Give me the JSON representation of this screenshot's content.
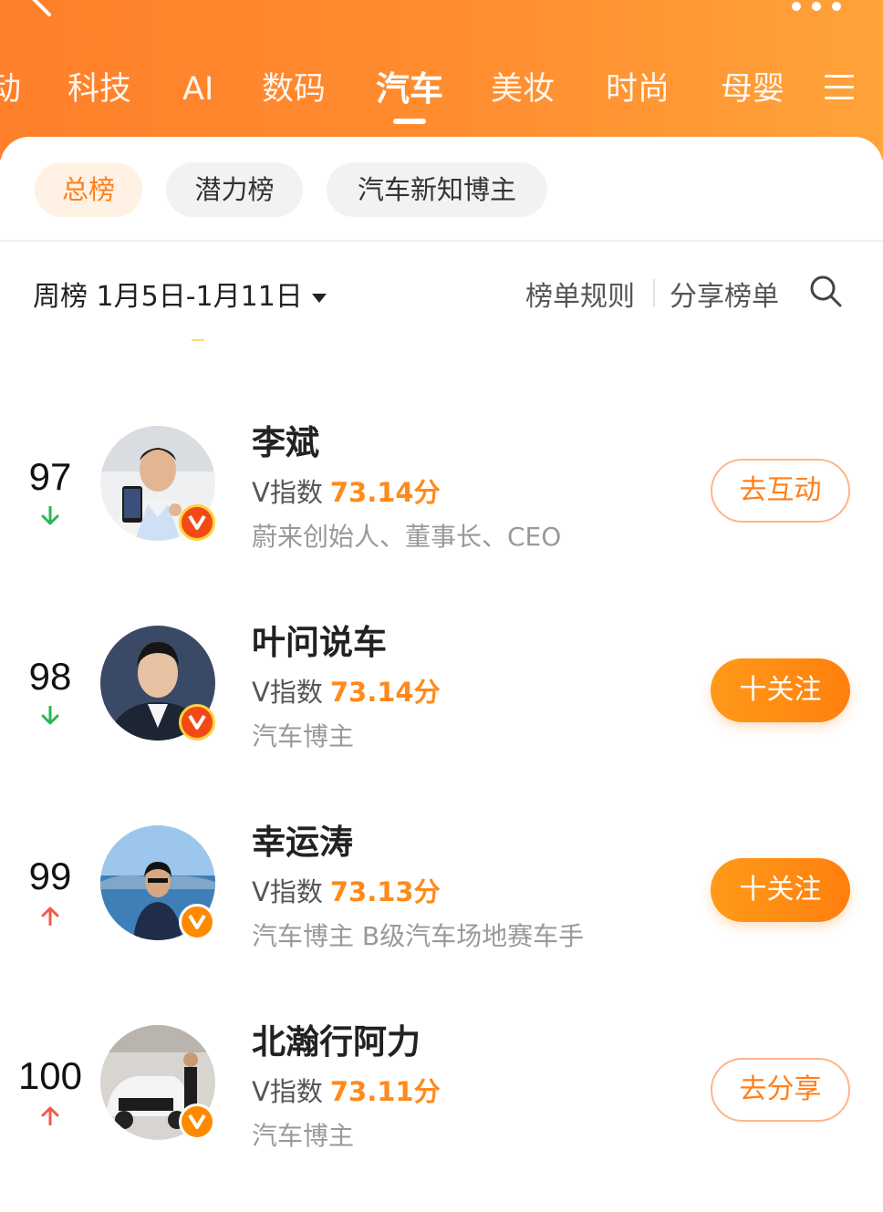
{
  "header": {
    "back_icon": "chevron-left-icon",
    "more_icon": "more-dots-icon",
    "tabs": [
      {
        "label": "动",
        "active": false
      },
      {
        "label": "科技",
        "active": false
      },
      {
        "label": "AI",
        "active": false
      },
      {
        "label": "数码",
        "active": false
      },
      {
        "label": "汽车",
        "active": true
      },
      {
        "label": "美妆",
        "active": false
      },
      {
        "label": "时尚",
        "active": false
      },
      {
        "label": "母婴",
        "active": false
      }
    ],
    "menu_icon": "menu-icon"
  },
  "filters": {
    "chips": [
      {
        "label": "总榜",
        "active": true
      },
      {
        "label": "潜力榜",
        "active": false
      },
      {
        "label": "汽车新知博主",
        "active": false
      }
    ]
  },
  "toolbar": {
    "period_label": "周榜 1月5日-1月11日",
    "rules_label": "榜单规则",
    "share_label": "分享榜单",
    "search_icon": "search-icon"
  },
  "list": {
    "score_prefix": "V指数",
    "items": [
      {
        "rank": "97",
        "trend": "down",
        "name": "李斌",
        "score": "73.14分",
        "desc": "蔚来创始人、董事长、CEO",
        "action": "去互动",
        "action_style": "outline",
        "badge": "red"
      },
      {
        "rank": "98",
        "trend": "down",
        "name": "叶问说车",
        "score": "73.14分",
        "desc": "汽车博主",
        "action": "十关注",
        "action_style": "filled",
        "badge": "red"
      },
      {
        "rank": "99",
        "trend": "up",
        "name": "幸运涛",
        "score": "73.13分",
        "desc": "汽车博主 B级汽车场地赛车手",
        "action": "十关注",
        "action_style": "filled",
        "badge": "orange"
      },
      {
        "rank": "100",
        "trend": "up",
        "name": "北瀚行阿力",
        "score": "73.11分",
        "desc": "汽车博主",
        "action": "去分享",
        "action_style": "outline",
        "badge": "orange"
      }
    ]
  },
  "colors": {
    "brand_orange": "#ff7f1a",
    "trend_down": "#2db552",
    "trend_up": "#f25a4a"
  }
}
